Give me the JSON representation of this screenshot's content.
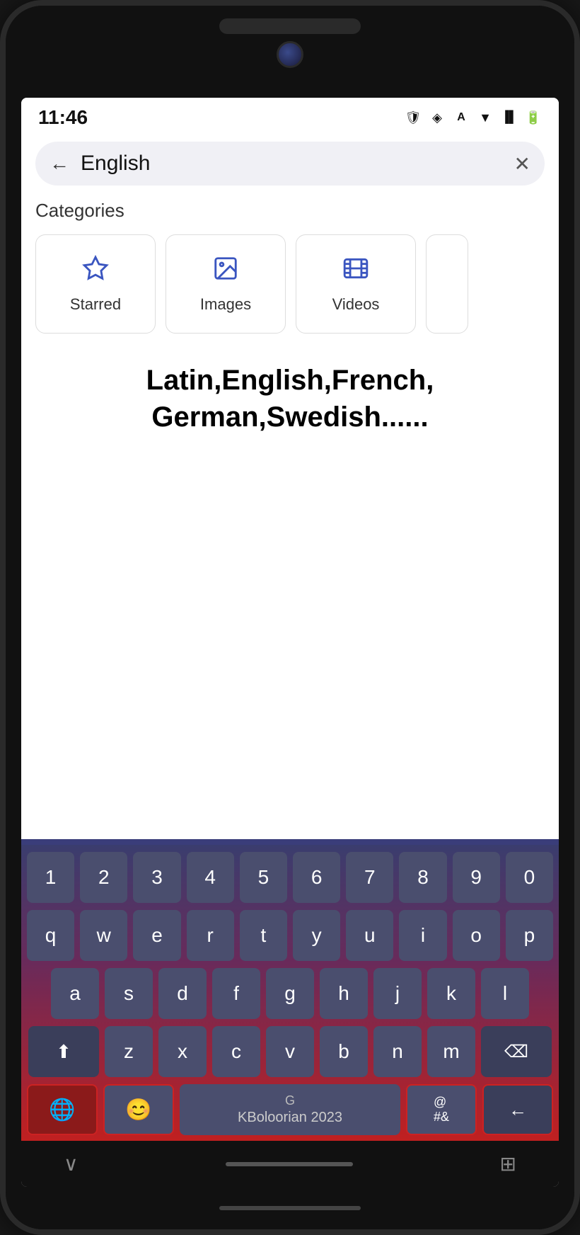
{
  "status_bar": {
    "time": "11:46",
    "icons": [
      "shield",
      "location",
      "text-a",
      "wifi",
      "signal",
      "battery"
    ]
  },
  "search": {
    "query": "English",
    "back_label": "←",
    "clear_label": "✕"
  },
  "categories": {
    "title": "Categories",
    "items": [
      {
        "id": "starred",
        "label": "Starred",
        "icon": "star"
      },
      {
        "id": "images",
        "label": "Images",
        "icon": "image"
      },
      {
        "id": "videos",
        "label": "Videos",
        "icon": "video"
      }
    ]
  },
  "languages_text": "Latin,English,French,\nGerman,Swedish......",
  "keyboard": {
    "row_numbers": [
      "1",
      "2",
      "3",
      "4",
      "5",
      "6",
      "7",
      "8",
      "9",
      "0"
    ],
    "row_q": [
      "q",
      "w",
      "e",
      "r",
      "t",
      "y",
      "u",
      "i",
      "o",
      "p"
    ],
    "row_a": [
      "a",
      "s",
      "d",
      "f",
      "g",
      "h",
      "j",
      "k",
      "l"
    ],
    "row_z": [
      "z",
      "x",
      "c",
      "v",
      "b",
      "n",
      "m"
    ],
    "space_text": "KBoloorian 2023",
    "symbols_label": "@ # &",
    "shift_icon": "⬆",
    "backspace_icon": "⌫",
    "globe_icon": "🌐",
    "emoji_icon": "😊",
    "enter_icon": "←"
  },
  "nav": {
    "chevron": "∨",
    "grid": "⊞"
  }
}
